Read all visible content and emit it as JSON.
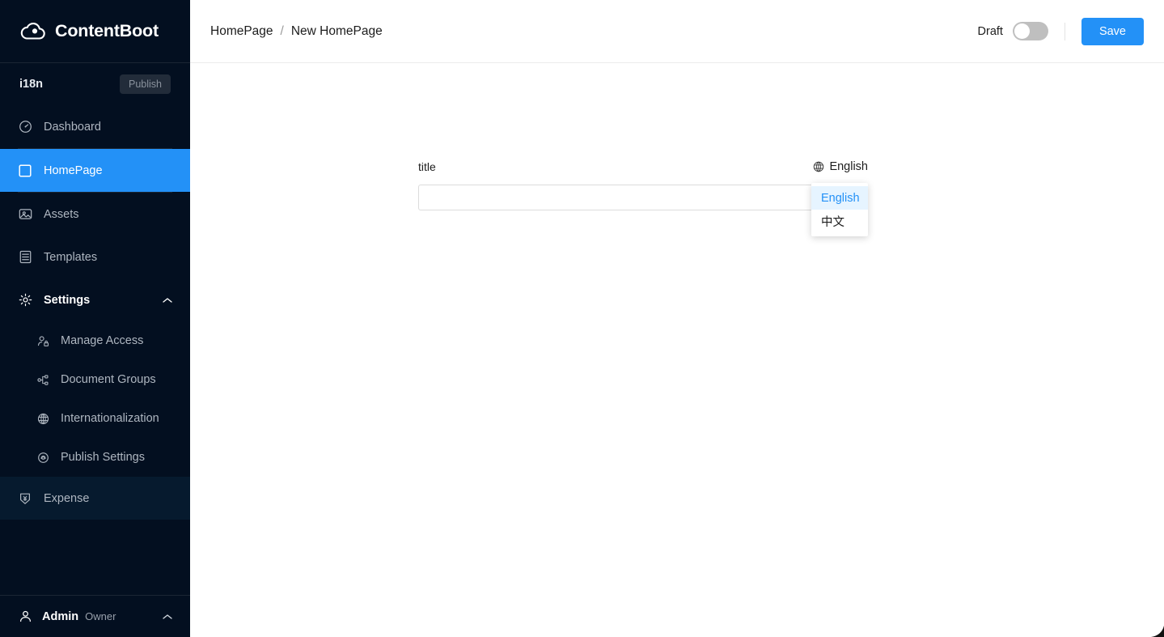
{
  "brand": {
    "name": "ContentBoot",
    "logo_icon": "cloud-icon"
  },
  "sidebar": {
    "project": {
      "name": "i18n",
      "publish_label": "Publish"
    },
    "items": [
      {
        "label": "Dashboard",
        "icon": "gauge-icon"
      },
      {
        "label": "HomePage",
        "icon": "square-icon"
      },
      {
        "label": "Assets",
        "icon": "image-icon"
      },
      {
        "label": "Templates",
        "icon": "template-icon"
      },
      {
        "label": "Settings",
        "icon": "gear-icon",
        "chevron": "chevron-up-icon"
      }
    ],
    "settings_children": [
      {
        "label": "Manage Access",
        "icon": "user-lock-icon"
      },
      {
        "label": "Document Groups",
        "icon": "sitemap-icon"
      },
      {
        "label": "Internationalization",
        "icon": "globe-icon"
      },
      {
        "label": "Publish Settings",
        "icon": "cloud-lock-icon"
      }
    ],
    "expense": {
      "label": "Expense",
      "icon": "yen-shield-icon"
    },
    "user": {
      "name": "Admin",
      "role": "Owner",
      "icon": "person-icon",
      "chevron": "chevron-up-icon"
    }
  },
  "header": {
    "breadcrumb": {
      "parent": "HomePage",
      "separator": "/",
      "current": "New HomePage"
    },
    "draft_label": "Draft",
    "draft_on": false,
    "save_label": "Save"
  },
  "form": {
    "title_field": {
      "label": "title",
      "value": "",
      "placeholder": ""
    },
    "language_selector": {
      "icon": "globe-icon",
      "selected": "English"
    },
    "language_menu": {
      "options": [
        {
          "label": "English",
          "selected": true
        },
        {
          "label": "中文",
          "selected": false
        }
      ]
    }
  },
  "colors": {
    "sidebar_bg": "#030f20",
    "accent": "#2391f7",
    "menu_highlight_bg": "#e6f4ff",
    "publish_btn_bg": "#222c3a",
    "toggle_off": "#bfbfbf"
  }
}
